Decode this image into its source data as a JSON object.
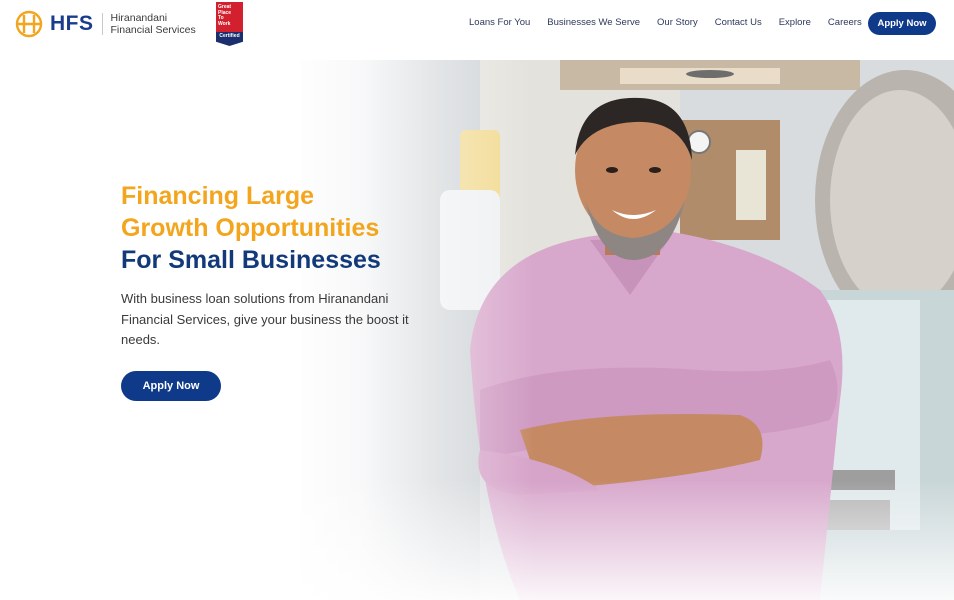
{
  "brand": {
    "logo_text": "HFS",
    "company_line1": "Hiranandani",
    "company_line2": "Financial Services",
    "badge_line1": "Great",
    "badge_line2": "Place",
    "badge_line3": "To",
    "badge_line4": "Work",
    "badge_bottom": "Certified",
    "colors": {
      "primary": "#0f3a8a",
      "accent": "#f2a51d",
      "badge_red": "#d3202e"
    }
  },
  "nav": {
    "items": [
      {
        "label": "Loans For You"
      },
      {
        "label": "Businesses We Serve"
      },
      {
        "label": "Our Story"
      },
      {
        "label": "Contact Us"
      },
      {
        "label": "Explore"
      },
      {
        "label": "Careers"
      }
    ],
    "apply_label": "Apply Now"
  },
  "hero": {
    "headline_line1": "Financing Large",
    "headline_line2": "Growth Opportunities",
    "headline_line3": "For Small Businesses",
    "subtext": "With business loan solutions from Hiranandani Financial Services, give your business the boost it needs.",
    "cta_label": "Apply Now",
    "image_icon": "smiling-shopkeeper-photo"
  }
}
